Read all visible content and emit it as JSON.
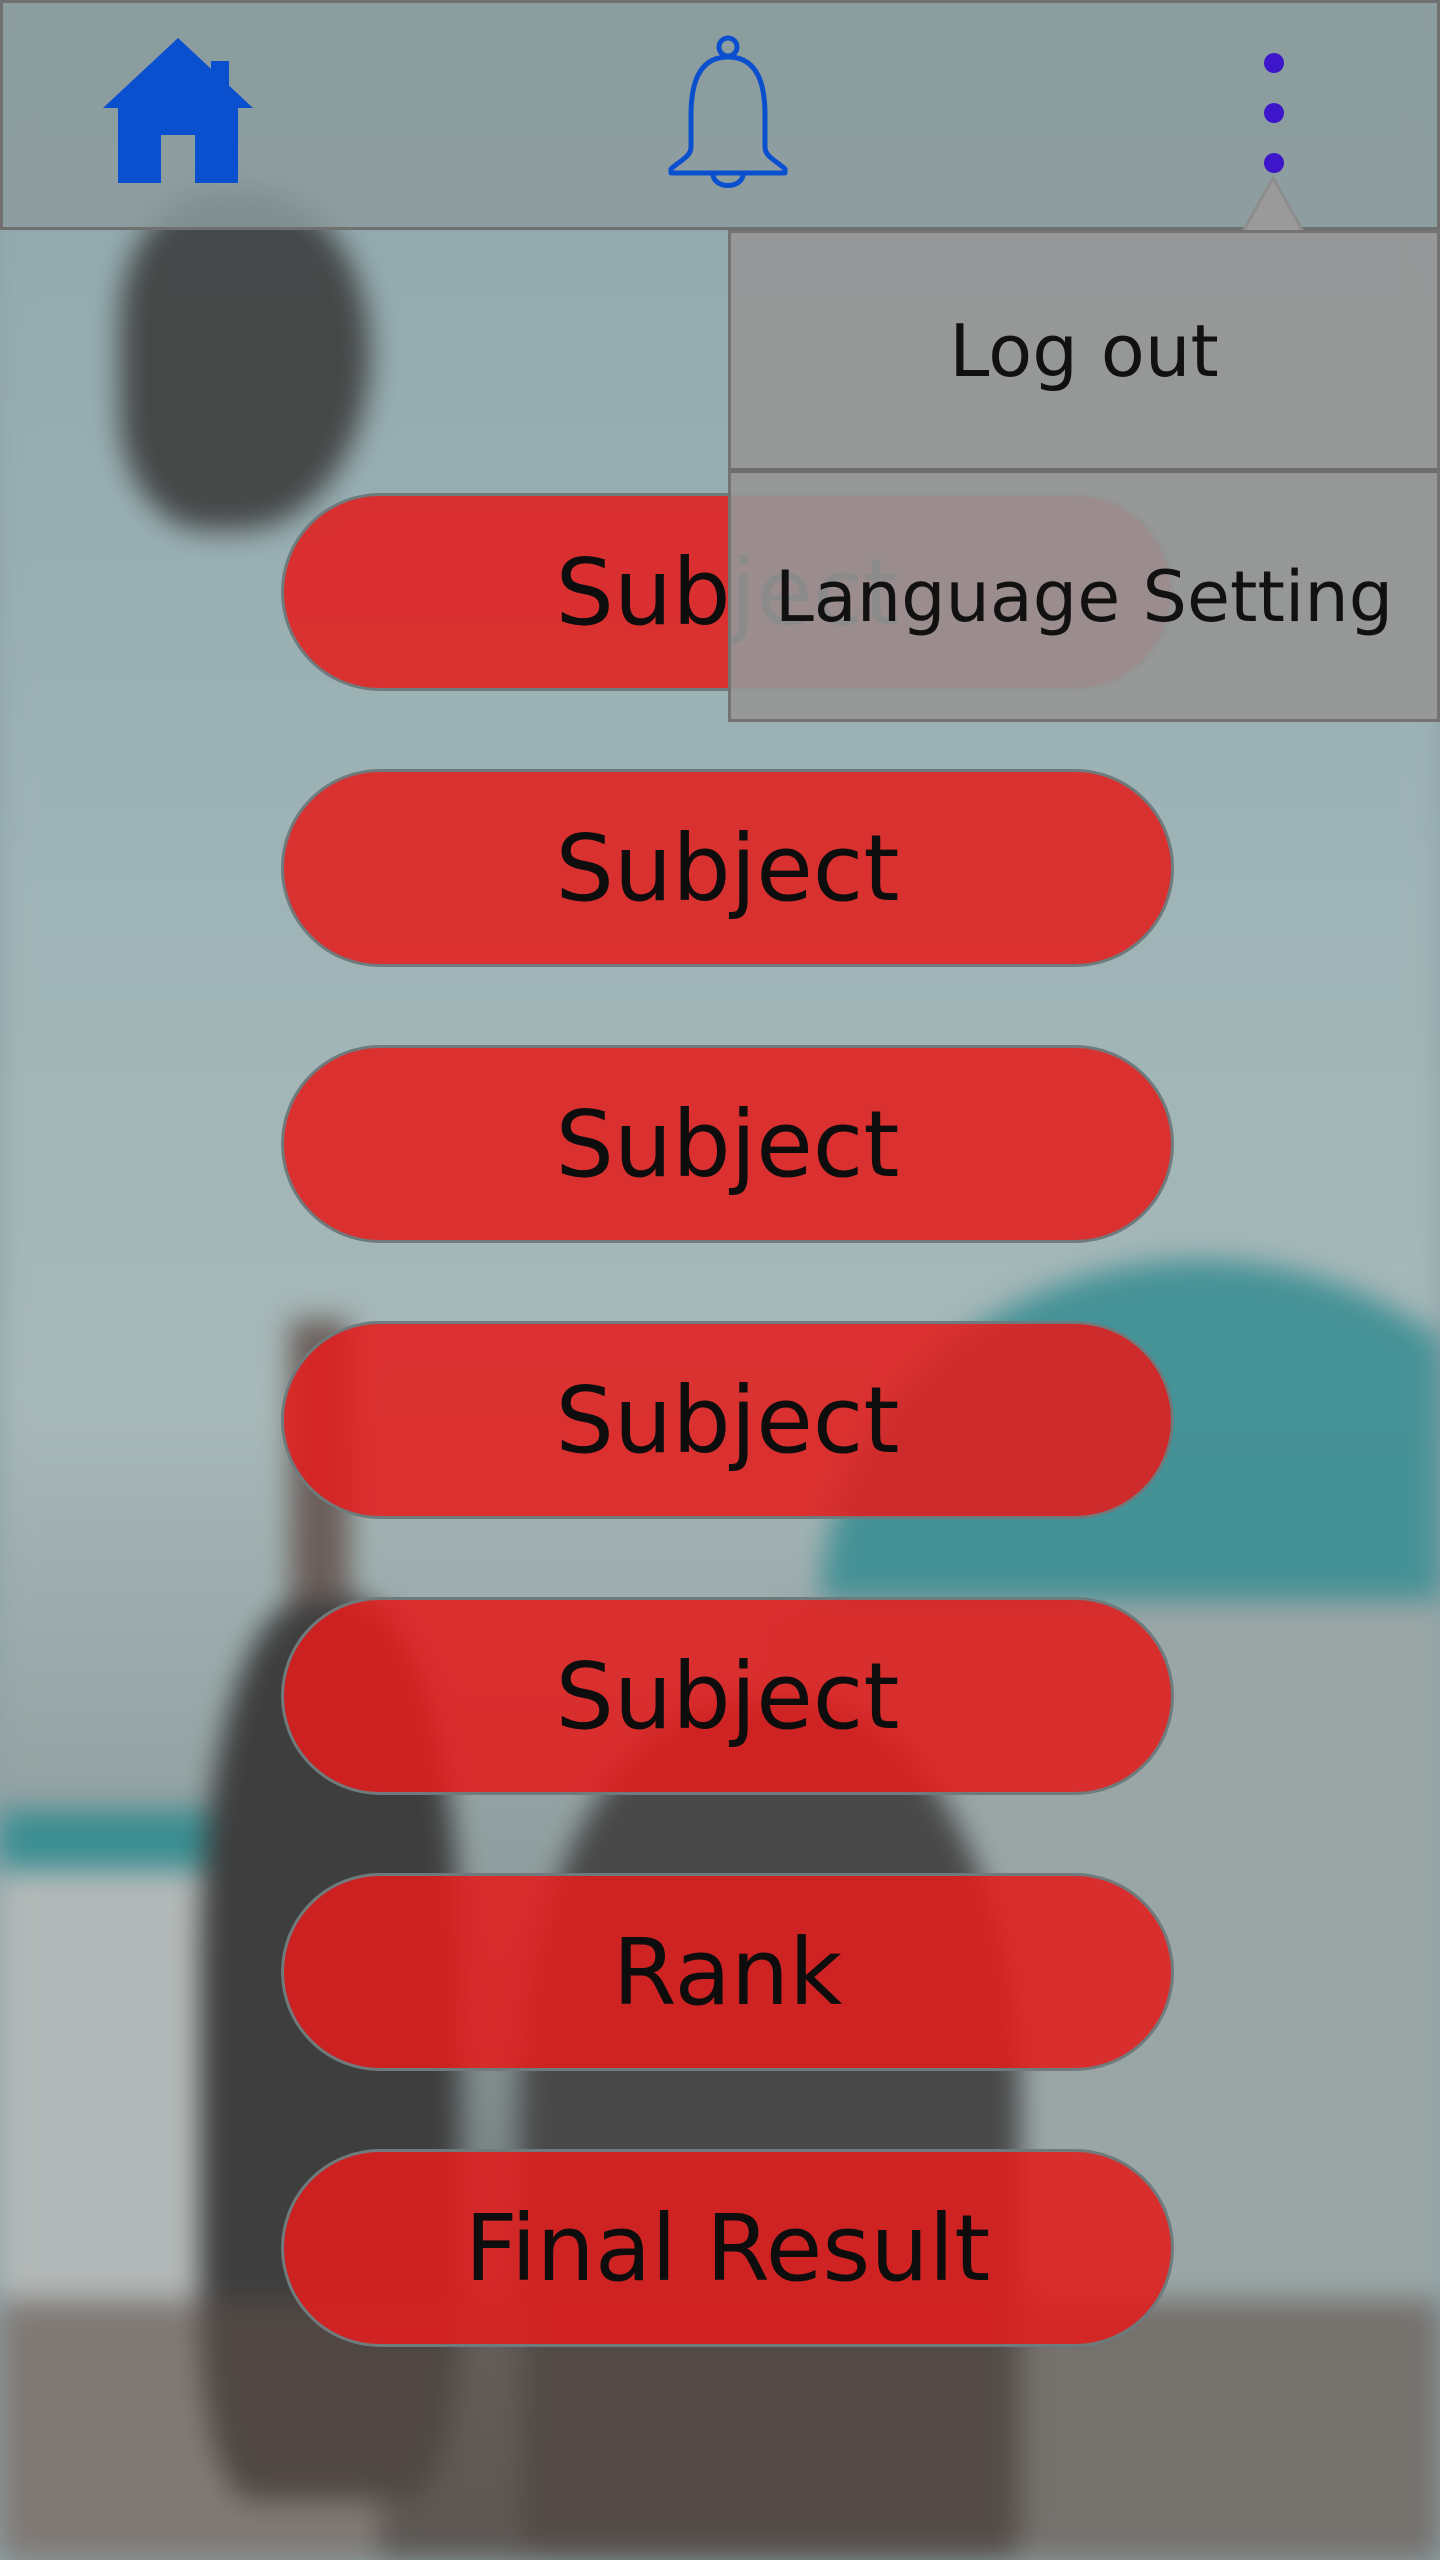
{
  "header": {
    "icons": [
      "home-icon",
      "bell-icon",
      "more-vert-icon"
    ]
  },
  "menu": {
    "items": [
      {
        "label": "Log out"
      },
      {
        "label": "Language Setting"
      }
    ]
  },
  "buttons": [
    {
      "label": "Subject"
    },
    {
      "label": "Subject"
    },
    {
      "label": "Subject"
    },
    {
      "label": "Subject"
    },
    {
      "label": "Subject"
    },
    {
      "label": "Rank"
    },
    {
      "label": "Final Result"
    }
  ],
  "colors": {
    "button_fill": "#e11e1e",
    "icon_blue": "#0a4fce",
    "kebab_dots": "#3d16c9",
    "menu_bg": "#969696"
  }
}
